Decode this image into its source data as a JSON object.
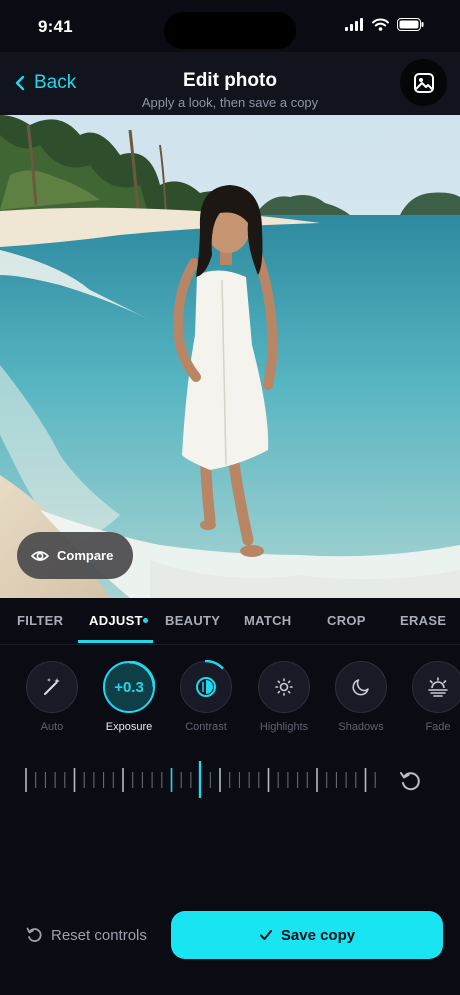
{
  "status": {
    "time": "9:41"
  },
  "header": {
    "back_label": "Back",
    "title": "Edit photo",
    "subtitle": "Apply a look, then save a copy"
  },
  "photo": {
    "compare_label": "Compare"
  },
  "tabs": [
    {
      "label": "FILTER",
      "active": false
    },
    {
      "label": "ADJUST",
      "active": true
    },
    {
      "label": "BEAUTY",
      "active": false
    },
    {
      "label": "MATCH",
      "active": false
    },
    {
      "label": "CROP",
      "active": false
    },
    {
      "label": "ERASE",
      "active": false
    }
  ],
  "tools": [
    {
      "label": "Auto",
      "icon": "magic-wand-icon"
    },
    {
      "label": "Exposure",
      "icon": "exposure-value",
      "value": "+0.3",
      "active": true
    },
    {
      "label": "Contrast",
      "icon": "contrast-icon"
    },
    {
      "label": "Highlights",
      "icon": "sun-icon"
    },
    {
      "label": "Shadows",
      "icon": "moon-icon"
    },
    {
      "label": "Fade",
      "icon": "sunset-icon"
    }
  ],
  "bottom": {
    "reset_label": "Reset controls",
    "save_label": "Save copy"
  },
  "colors": {
    "accent": "#1ed9ee",
    "background": "#0b0c13"
  }
}
